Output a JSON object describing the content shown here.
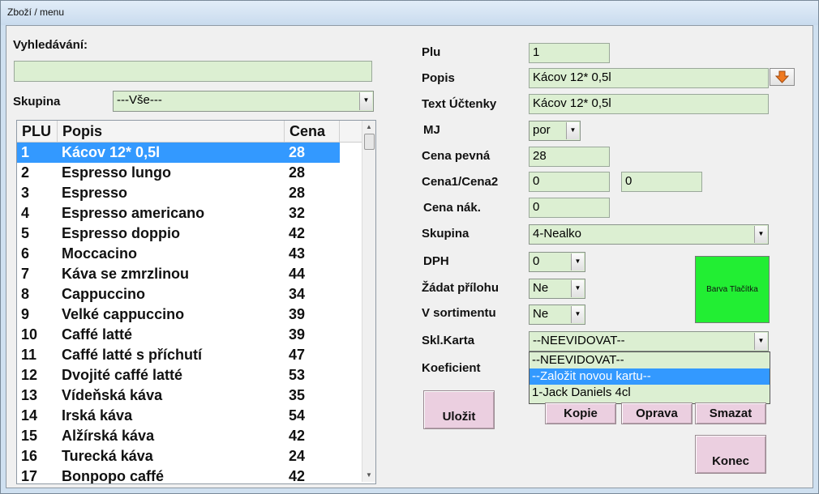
{
  "window": {
    "title": "Zboží / menu"
  },
  "search": {
    "label": "Vyhledávání:",
    "value": ""
  },
  "group_filter": {
    "label": "Skupina",
    "value": "---Vše---"
  },
  "table": {
    "columns": [
      "PLU",
      "Popis",
      "Cena"
    ],
    "rows": [
      {
        "plu": "1",
        "popis": "Kácov 12* 0,5l",
        "cena": "28"
      },
      {
        "plu": "2",
        "popis": "Espresso lungo",
        "cena": "28"
      },
      {
        "plu": "3",
        "popis": "Espresso",
        "cena": "28"
      },
      {
        "plu": "4",
        "popis": "Espresso americano",
        "cena": "32"
      },
      {
        "plu": "5",
        "popis": "Espresso doppio",
        "cena": "42"
      },
      {
        "plu": "6",
        "popis": "Moccacino",
        "cena": "43"
      },
      {
        "plu": "7",
        "popis": "Káva se zmrzlinou",
        "cena": "44"
      },
      {
        "plu": "8",
        "popis": "Cappuccino",
        "cena": "34"
      },
      {
        "plu": "9",
        "popis": "Velké cappuccino",
        "cena": "39"
      },
      {
        "plu": "10",
        "popis": "Caffé latté",
        "cena": "39"
      },
      {
        "plu": "11",
        "popis": "Caffé latté s příchutí",
        "cena": "47"
      },
      {
        "plu": "12",
        "popis": "Dvojité caffé latté",
        "cena": "53"
      },
      {
        "plu": "13",
        "popis": "Vídeňská káva",
        "cena": "35"
      },
      {
        "plu": "14",
        "popis": "Irská káva",
        "cena": "54"
      },
      {
        "plu": "15",
        "popis": "Alžírská káva",
        "cena": "42"
      },
      {
        "plu": "16",
        "popis": "Turecká káva",
        "cena": "24"
      },
      {
        "plu": "17",
        "popis": "Bonpopo caffé",
        "cena": "42"
      }
    ],
    "selected_index": 0
  },
  "form": {
    "plu": {
      "label": "Plu",
      "value": "1"
    },
    "popis": {
      "label": "Popis",
      "value": "Kácov 12* 0,5l"
    },
    "text_uctenky": {
      "label": "Text Účtenky",
      "value": "Kácov 12* 0,5l"
    },
    "mj": {
      "label": "MJ",
      "value": "por"
    },
    "cena_pevna": {
      "label": "Cena pevná",
      "value": "28"
    },
    "cena12": {
      "label": "Cena1/Cena2",
      "value1": "0",
      "value2": "0"
    },
    "cena_nak": {
      "label": "Cena nák.",
      "value": "0"
    },
    "skupina": {
      "label": "Skupina",
      "value": "4-Nealko"
    },
    "dph": {
      "label": "DPH",
      "value": "0"
    },
    "zadat_prilohu": {
      "label": "Žádat přílohu",
      "value": "Ne"
    },
    "v_sortimentu": {
      "label": "V sortimentu",
      "value": "Ne"
    },
    "skl_karta": {
      "label": "Skl.Karta",
      "value": "--NEEVIDOVAT--",
      "options": [
        "--NEEVIDOVAT--",
        "--Založit novou kartu--",
        "1-Jack Daniels 4cl"
      ],
      "highlighted": 1
    },
    "koeficient": {
      "label": "Koeficient"
    }
  },
  "button_color": {
    "label": "Barva Tlačítka",
    "color": "#22ee33"
  },
  "buttons": {
    "ulozit": "Uložit",
    "kopie": "Kopie",
    "oprava": "Oprava",
    "smazat": "Smazat",
    "konec": "Konec"
  }
}
